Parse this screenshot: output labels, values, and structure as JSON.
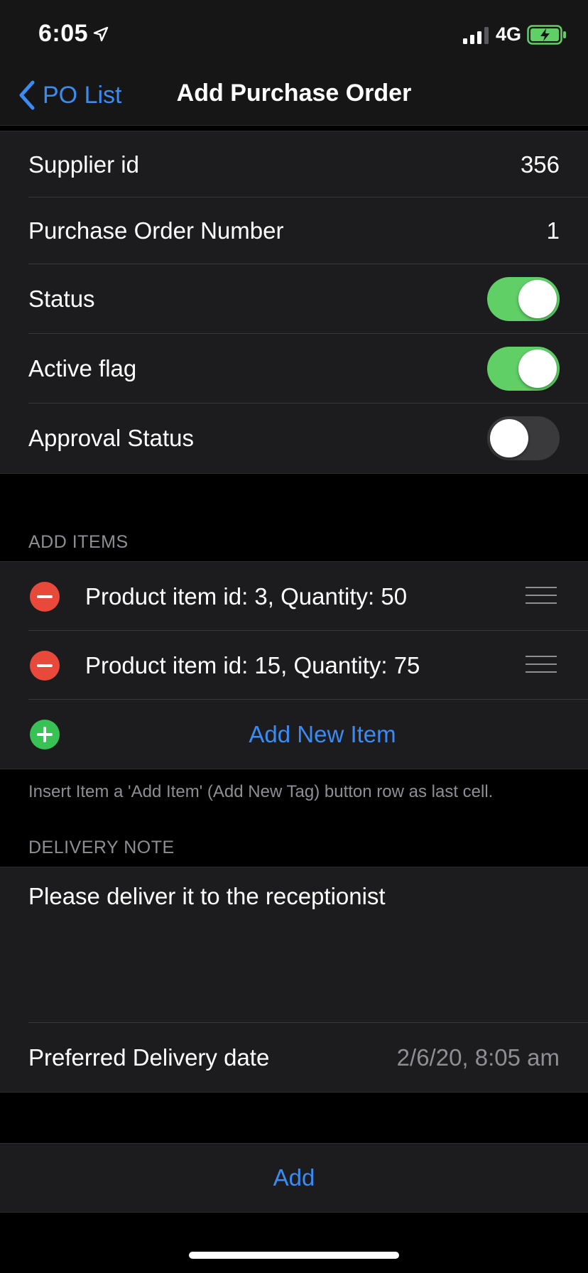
{
  "status_bar": {
    "time": "6:05",
    "network": "4G",
    "location_icon": "location-arrow-icon",
    "signal_icon": "signal-bars-icon",
    "battery_icon": "battery-charging-icon",
    "battery_color": "#5fcf66"
  },
  "nav": {
    "back_label": "PO List",
    "back_icon": "chevron-left-icon",
    "title": "Add Purchase Order",
    "accent_color": "#3a8bf2"
  },
  "details": {
    "supplier_id_label": "Supplier id",
    "supplier_id_value": "356",
    "po_number_label": "Purchase Order Number",
    "po_number_value": "1",
    "status_label": "Status",
    "status_on": true,
    "active_flag_label": "Active flag",
    "active_flag_on": true,
    "approval_status_label": "Approval Status",
    "approval_status_on": false,
    "toggle_on_color": "#5fcf66"
  },
  "items_section": {
    "header": "ADD ITEMS",
    "items": [
      {
        "label": "Product item id: 3, Quantity: 50"
      },
      {
        "label": "Product item id: 15, Quantity: 75"
      }
    ],
    "add_new_label": "Add New Item",
    "footer": "Insert Item a 'Add Item' (Add New Tag) button row as last cell.",
    "remove_color": "#e9493b",
    "add_color": "#38c155"
  },
  "delivery_section": {
    "header": "DELIVERY NOTE",
    "note_text": "Please deliver it to the receptionist",
    "date_label": "Preferred Delivery date",
    "date_value": "2/6/20, 8:05 am"
  },
  "submit": {
    "add_label": "Add"
  }
}
